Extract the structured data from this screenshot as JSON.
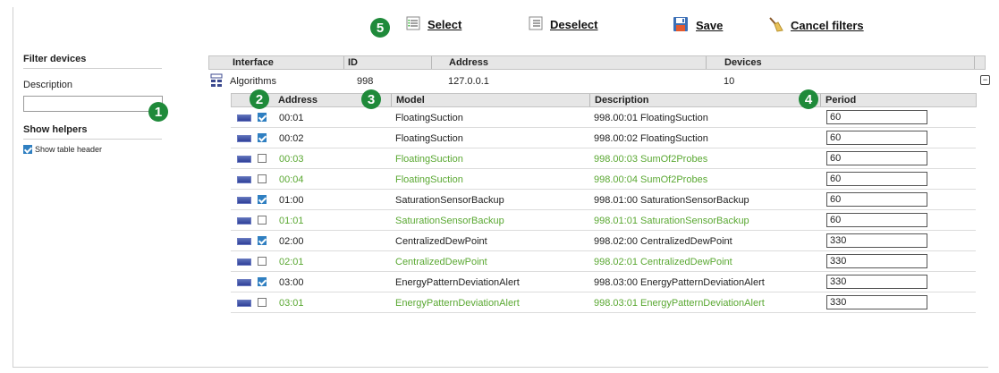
{
  "toolbar": {
    "step_badge": "5",
    "select_label": "Select",
    "deselect_label": "Deselect",
    "save_label": "Save",
    "cancel_filters_label": "Cancel filters"
  },
  "sidebar": {
    "filter_title": "Filter devices",
    "description_label": "Description",
    "description_value": "",
    "badge": "1",
    "helpers_title": "Show helpers",
    "show_header_label": "Show table header",
    "show_header_checked": true
  },
  "interface_table": {
    "headers": [
      "Interface",
      "ID",
      "Address",
      "Devices"
    ],
    "row": {
      "interface": "Algorithms",
      "id": "998",
      "address": "127.0.0.1",
      "devices": "10"
    }
  },
  "device_table": {
    "badges": [
      "2",
      "3",
      "4"
    ],
    "headers": {
      "address": "Address",
      "model": "Model",
      "description": "Description",
      "period": "Period"
    },
    "rows": [
      {
        "checked": true,
        "address": "00:01",
        "model": "FloatingSuction",
        "description": "998.00:01 FloatingSuction",
        "period": "60"
      },
      {
        "checked": true,
        "address": "00:02",
        "model": "FloatingSuction",
        "description": "998.00:02 FloatingSuction",
        "period": "60"
      },
      {
        "checked": false,
        "address": "00:03",
        "model": "FloatingSuction",
        "description": "998.00:03 SumOf2Probes",
        "period": "60"
      },
      {
        "checked": false,
        "address": "00:04",
        "model": "FloatingSuction",
        "description": "998.00:04 SumOf2Probes",
        "period": "60"
      },
      {
        "checked": true,
        "address": "01:00",
        "model": "SaturationSensorBackup",
        "description": "998.01:00 SaturationSensorBackup",
        "period": "60"
      },
      {
        "checked": false,
        "address": "01:01",
        "model": "SaturationSensorBackup",
        "description": "998.01:01 SaturationSensorBackup",
        "period": "60"
      },
      {
        "checked": true,
        "address": "02:00",
        "model": "CentralizedDewPoint",
        "description": "998.02:00 CentralizedDewPoint",
        "period": "330"
      },
      {
        "checked": false,
        "address": "02:01",
        "model": "CentralizedDewPoint",
        "description": "998.02:01 CentralizedDewPoint",
        "period": "330"
      },
      {
        "checked": true,
        "address": "03:00",
        "model": "EnergyPatternDeviationAlert",
        "description": "998.03:00 EnergyPatternDeviationAlert",
        "period": "330"
      },
      {
        "checked": false,
        "address": "03:01",
        "model": "EnergyPatternDeviationAlert",
        "description": "998.03:01 EnergyPatternDeviationAlert",
        "period": "330"
      }
    ]
  },
  "colors": {
    "badge": "#1f8a3a",
    "dim_text": "#5aa832",
    "checkbox": "#2f7fc1"
  }
}
